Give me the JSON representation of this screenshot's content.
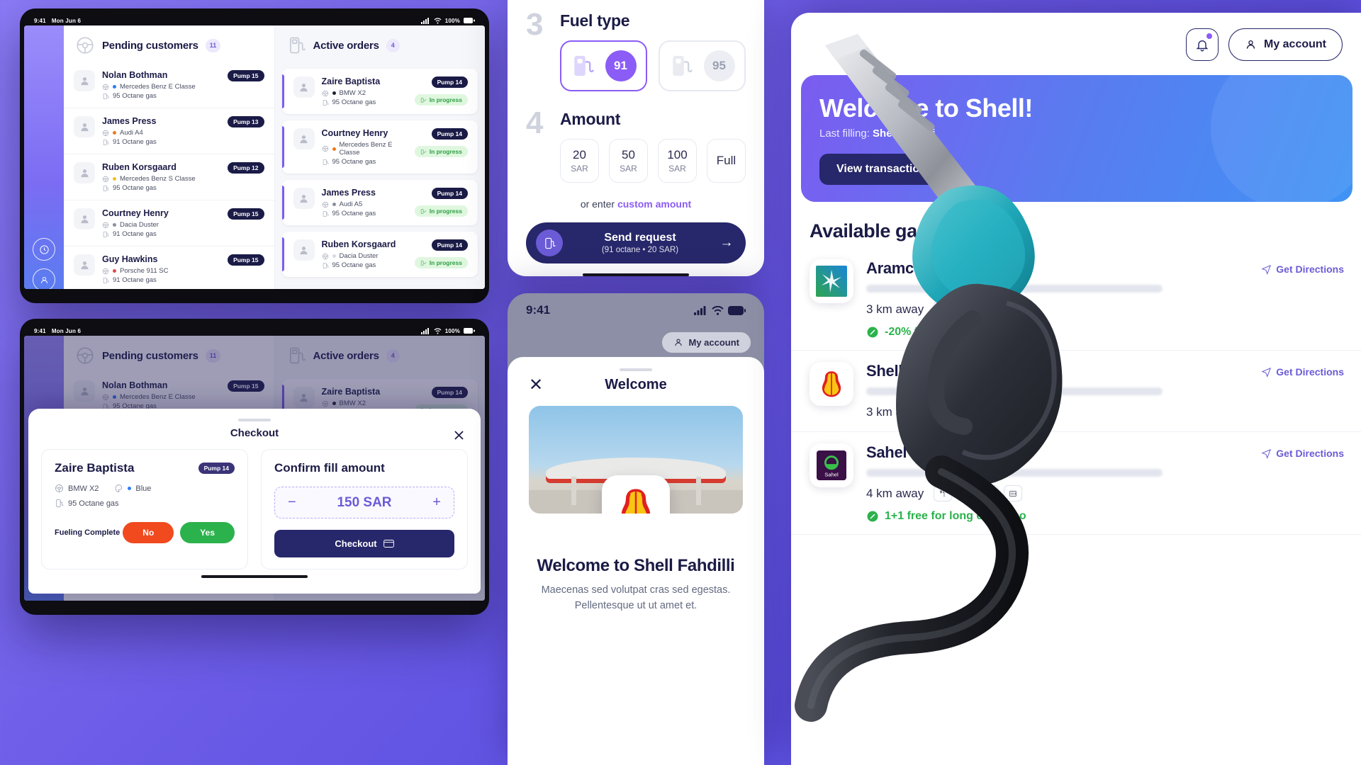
{
  "tablet1": {
    "status_time": "9:41",
    "status_date": "Mon Jun 6",
    "status_battery": "100%",
    "pending": {
      "title": "Pending customers",
      "count": "11",
      "icon": "steering-wheel-icon",
      "rows": [
        {
          "name": "Nolan Bothman",
          "car": "Mercedes Benz E Classe",
          "color": "#2f7cf6",
          "fuel": "95 Octane gas",
          "pump": "Pump 15"
        },
        {
          "name": "James Press",
          "car": "Audi A4",
          "color": "#f07a1e",
          "fuel": "91 Octane gas",
          "pump": "Pump 13"
        },
        {
          "name": "Ruben Korsgaard",
          "car": "Mercedes Benz S Classe",
          "color": "#f0c020",
          "fuel": "95 Octane gas",
          "pump": "Pump 12"
        },
        {
          "name": "Courtney Henry",
          "car": "Dacia Duster",
          "color": "#8a8f9e",
          "fuel": "91 Octane gas",
          "pump": "Pump 15"
        },
        {
          "name": "Guy Hawkins",
          "car": "Porsche 911 SC",
          "color": "#e04a4a",
          "fuel": "91 Octane gas",
          "pump": "Pump 15"
        }
      ]
    },
    "active": {
      "title": "Active orders",
      "count": "4",
      "icon": "fuel-pump-icon",
      "rows": [
        {
          "name": "Zaire Baptista",
          "car": "BMW X2",
          "color": "#222233",
          "fuel": "95 Octane gas",
          "pump": "Pump 14",
          "status": "In progress"
        },
        {
          "name": "Courtney Henry",
          "car": "Mercedes Benz E Classe",
          "color": "#f07a1e",
          "fuel": "95 Octane gas",
          "pump": "Pump 14",
          "status": "In progress"
        },
        {
          "name": "James Press",
          "car": "Audi A5",
          "color": "#8a8f9e",
          "fuel": "95 Octane gas",
          "pump": "Pump 14",
          "status": "In progress"
        },
        {
          "name": "Ruben Korsgaard",
          "car": "Dacia Duster",
          "color": "#d8dbe3",
          "fuel": "95 Octane gas",
          "pump": "Pump 14",
          "status": "In progress"
        }
      ]
    }
  },
  "tablet2": {
    "status_time": "9:41",
    "status_date": "Mon Jun 6",
    "status_battery": "100%",
    "checkout": {
      "title": "Checkout",
      "close_icon": "close-icon",
      "customer": {
        "name": "Zaire Baptista",
        "pump": "Pump 14",
        "car": "BMW X2",
        "car_color_label": "Blue",
        "car_color": "#2f7cf6",
        "fuel": "95 Octane gas",
        "fueling_label": "Fueling Complete",
        "no_label": "No",
        "yes_label": "Yes"
      },
      "confirm": {
        "title": "Confirm fill amount",
        "minus": "−",
        "plus": "+",
        "amount": "150 SAR",
        "button": "Checkout",
        "button_icon": "card-icon"
      }
    }
  },
  "fuel_card": {
    "step3": {
      "number": "3",
      "title": "Fuel type",
      "options": [
        {
          "label": "91",
          "selected": true
        },
        {
          "label": "95",
          "selected": false
        }
      ]
    },
    "step4": {
      "number": "4",
      "title": "Amount",
      "options": [
        {
          "value": "20",
          "unit": "SAR"
        },
        {
          "value": "50",
          "unit": "SAR"
        },
        {
          "value": "100",
          "unit": "SAR"
        },
        {
          "value": "Full",
          "unit": ""
        }
      ],
      "custom_prefix": "or enter ",
      "custom_link": "custom amount"
    },
    "send": {
      "label": "Send request",
      "sub": "(91 octane • 20 SAR)",
      "arrow": "→",
      "icon": "fuel-request-icon"
    }
  },
  "phone": {
    "status_time": "9:41",
    "account_label": "My account",
    "sheet": {
      "title": "Welcome",
      "close_icon": "close-icon",
      "heading": "Welcome to Shell Fahdilli",
      "body_line1": "Maecenas sed volutpat cras sed egestas.",
      "body_line2": "Pellentesque ut ut amet et."
    }
  },
  "right_panel": {
    "bell_icon": "bell-icon",
    "account_label": "My account",
    "promo": {
      "heading": "Welcome to Shell!",
      "sub_prefix": "Last filling: ",
      "sub_value": "Shell Fadhili",
      "button": "View transactions"
    },
    "section_title": "Available gas stations",
    "stations": [
      {
        "name": "Aramco Fadhili",
        "logo": "aramco-logo",
        "distance": "3 km away",
        "offer": "-20% for car washes",
        "offer_icon": "discount-icon",
        "directions": "Get Directions",
        "amenities": [
          "restaurant-icon",
          "service-icon",
          "car-wash-icon",
          "atm-icon"
        ]
      },
      {
        "name": "Shell Fadhilli",
        "logo": "shell-logo",
        "distance": "3 km away",
        "offer": "",
        "offer_icon": "",
        "directions": "Get Directions",
        "amenities": [
          "restaurant-icon",
          "car-wash-icon",
          "atm-icon"
        ]
      },
      {
        "name": "Sahel Fadhili",
        "logo": "sahel-logo",
        "distance": "4 km away",
        "offer": "1+1 free for long espresso",
        "offer_icon": "coffee-icon",
        "directions": "Get Directions",
        "amenities": [
          "restaurant-icon",
          "service-icon",
          "car-wash-icon",
          "atm-icon"
        ]
      }
    ]
  }
}
